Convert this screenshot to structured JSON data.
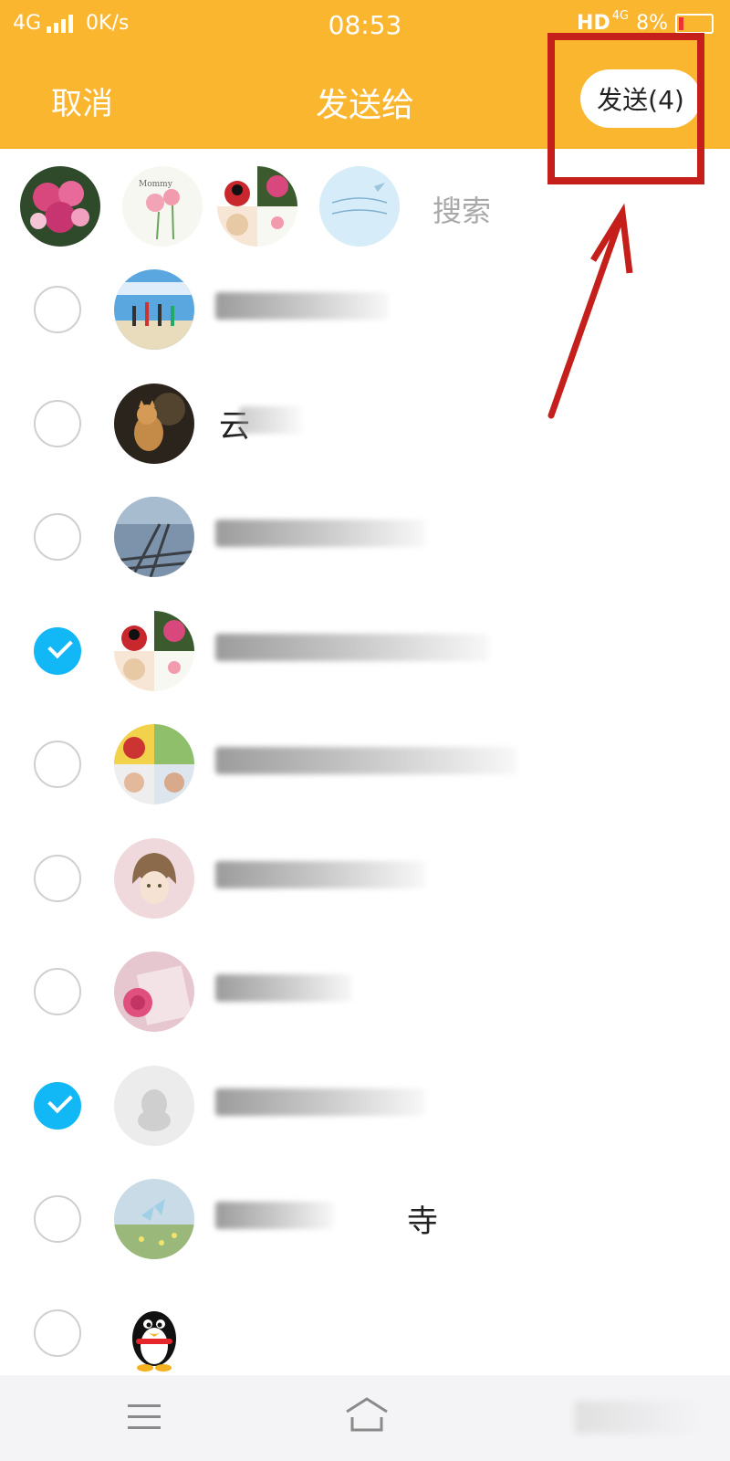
{
  "status_bar": {
    "network": "4G",
    "speed": "0K/s",
    "time": "08:53",
    "hd": "HD",
    "net_small": "4G",
    "battery": "8%"
  },
  "nav": {
    "cancel": "取消",
    "title": "发送给",
    "send": "发送(4)"
  },
  "search": {
    "label": "搜索"
  },
  "contacts": [
    {
      "name": "",
      "checked": false
    },
    {
      "name": "云",
      "checked": false
    },
    {
      "name": "",
      "checked": false
    },
    {
      "name": "",
      "checked": true
    },
    {
      "name": "",
      "checked": false
    },
    {
      "name": "",
      "checked": false
    },
    {
      "name": "",
      "checked": false
    },
    {
      "name": "",
      "checked": true
    },
    {
      "name": "寺",
      "checked": false
    },
    {
      "name": "",
      "checked": false
    }
  ],
  "colors": {
    "header": "#fbb62f",
    "checked": "#12b7f5",
    "annotation": "#c41f1a"
  }
}
